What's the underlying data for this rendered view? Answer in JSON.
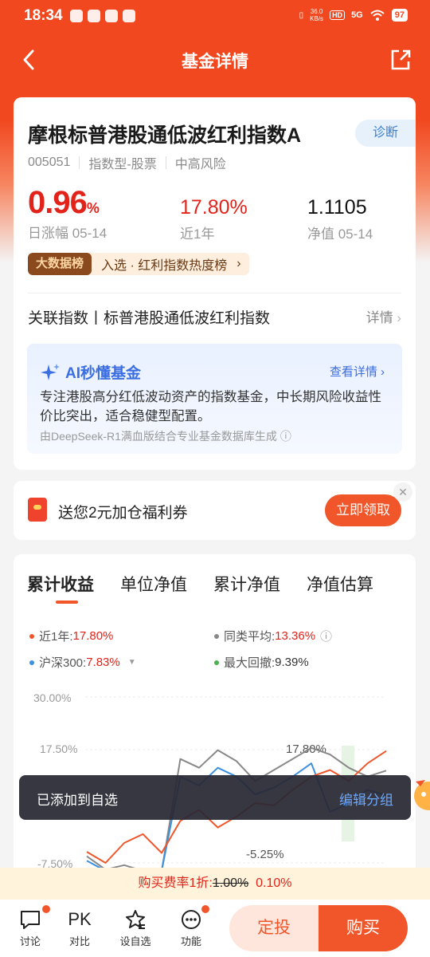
{
  "status_bar": {
    "time": "18:34",
    "net_speed_value": "36.0",
    "net_speed_unit": "KB/s",
    "hd": "HD",
    "signal": "5G",
    "battery": "97"
  },
  "nav": {
    "title": "基金详情",
    "back_icon": "chevron-left-icon",
    "share_icon": "share-icon"
  },
  "fund": {
    "name": "摩根标普港股通低波红利指数A",
    "diagnose": "诊断",
    "code": "005051",
    "category": "指数型-股票",
    "risk": "中高风险",
    "daily_change": {
      "value": "0.96",
      "unit": "%",
      "label": "日涨幅 05-14"
    },
    "year_return": {
      "value": "17.80%",
      "label": "近1年"
    },
    "nav": {
      "value": "1.1105",
      "label": "净值 05-14"
    },
    "rank_badge": "大数据榜",
    "rank_text": "入选 · 红利指数热度榜"
  },
  "related_index": {
    "label": "关联指数丨标普港股通低波红利指数",
    "detail": "详情"
  },
  "ai": {
    "title": "AI秒懂基金",
    "more": "查看详情",
    "body": "专注港股高分红低波动资产的指数基金，中长期风险收益性价比突出，适合稳健型配置。",
    "source": "由DeepSeek-R1满血版结合专业基金数据库生成"
  },
  "coupon": {
    "text": "送您2元加仓福利券",
    "button": "立即领取"
  },
  "chart": {
    "tabs": [
      "累计收益",
      "单位净值",
      "累计净值",
      "净值估算"
    ],
    "legend": {
      "fund_label": "近1年:",
      "fund_value": "17.80%",
      "peer_label": "同类平均:",
      "peer_value": "13.36%",
      "index_label": "沪深300:",
      "index_value": "7.83%",
      "drawdown_label": "最大回撤:",
      "drawdown_value": "9.39%"
    },
    "colors": {
      "fund": "#f0562a",
      "peer": "#888888",
      "index": "#3d8fe0",
      "drawdown": "#4cb050"
    }
  },
  "chart_data": {
    "type": "line",
    "y_ticks": [
      "30.00%",
      "17.50%",
      "-7.50%"
    ],
    "annotations": [
      "17.80%",
      "-5.25%"
    ],
    "series": [
      {
        "name": "近1年",
        "values": [
          -5.0,
          -7.5,
          -3.0,
          -1.0,
          -5.25,
          2.0,
          4.5,
          0.5,
          3.0,
          6.0,
          5.5,
          9.0,
          12.0,
          13.5,
          11.0,
          15.0,
          17.8
        ]
      },
      {
        "name": "同类平均",
        "values": [
          -6.0,
          -9.0,
          -8.0,
          -14.0,
          -20.0,
          16.0,
          14.0,
          18.0,
          15.5,
          11.0,
          13.5,
          16.0,
          18.5,
          17.0,
          14.0,
          12.0,
          13.36
        ]
      },
      {
        "name": "沪深300",
        "values": [
          -7.0,
          -10.0,
          -12.0,
          -15.0,
          -18.0,
          12.0,
          10.0,
          14.0,
          12.0,
          8.0,
          9.5,
          12.0,
          15.0,
          4.0,
          6.0,
          9.0,
          7.83
        ]
      }
    ],
    "ylim": [
      -7.5,
      30.0
    ]
  },
  "toast": {
    "message": "已添加到自选",
    "action": "编辑分组"
  },
  "fee": {
    "prefix": "购买费率1折:",
    "old": "1.00%",
    "new": "0.10%"
  },
  "bottom_bar": {
    "discuss": "讨论",
    "compare_icon_text": "PK",
    "compare": "对比",
    "watchlist": "设自选",
    "functions": "功能",
    "dingtou": "定投",
    "buy": "购买"
  }
}
